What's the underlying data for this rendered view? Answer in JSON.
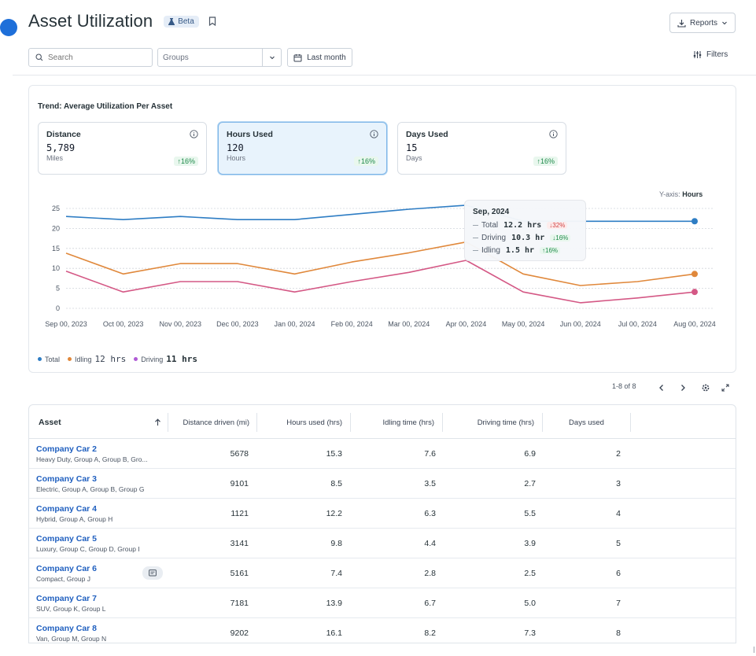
{
  "header": {
    "title": "Asset Utilization",
    "badge": "Beta",
    "reports_label": "Reports"
  },
  "toolbar": {
    "search_placeholder": "Search",
    "groups_placeholder": "Groups",
    "date_label": "Last month",
    "filters_label": "Filters"
  },
  "trend": {
    "title": "Trend: Average Utilization Per Asset",
    "kpis": [
      {
        "label": "Distance",
        "value": "5,789",
        "unit": "Miles",
        "change": "↑16%"
      },
      {
        "label": "Hours Used",
        "value": "120",
        "unit": "Hours",
        "change": "↑16%"
      },
      {
        "label": "Days Used",
        "value": "15",
        "unit": "Days",
        "change": "↑16%"
      }
    ],
    "yaxis_prefix": "Y-axis:",
    "yaxis_value": "Hours",
    "tooltip": {
      "title": "Sep, 2024",
      "rows": [
        {
          "label": "Total",
          "value": "12.2 hrs",
          "change": "↓32%",
          "dir": "down"
        },
        {
          "label": "Driving",
          "value": "10.3 hr",
          "change": "↓16%",
          "dir": "down"
        },
        {
          "label": "Idling",
          "value": "1.5 hr",
          "change": "↑16%",
          "dir": "up"
        }
      ]
    },
    "legend": {
      "total": "Total",
      "idling": "Idling",
      "idling_value": "12 hrs",
      "driving": "Driving",
      "driving_value": "11 hrs"
    }
  },
  "chart_data": {
    "type": "line",
    "x": [
      "Sep 00, 2023",
      "Oct 00, 2023",
      "Nov 00, 2023",
      "Dec 00, 2023",
      "Jan 00, 2024",
      "Feb 00, 2024",
      "Mar 00, 2024",
      "Apr 00, 2024",
      "May 00, 2024",
      "Jun 00, 2024",
      "Jul 00, 2024",
      "Aug 00, 2024"
    ],
    "yticks": [
      0,
      5,
      10,
      15,
      20,
      25
    ],
    "ylim": [
      0,
      25
    ],
    "series": [
      {
        "name": "Total",
        "color": "#2e7dc4",
        "values": [
          23,
          22.2,
          23,
          22.2,
          22.2,
          23.5,
          24.8,
          25.8,
          21.8,
          21.8,
          21.8,
          21.8
        ]
      },
      {
        "name": "Idling",
        "color": "#e0883b",
        "values": [
          13.8,
          8.6,
          11.2,
          11.2,
          8.6,
          11.6,
          13.9,
          16.6,
          8.6,
          5.7,
          6.7,
          8.6
        ]
      },
      {
        "name": "Driving",
        "color": "#d45885",
        "values": [
          9.3,
          4.1,
          6.7,
          6.7,
          4.1,
          6.7,
          9.0,
          12.0,
          4.1,
          1.4,
          2.6,
          4.1
        ]
      }
    ],
    "grid": true,
    "legend": "bottom-left"
  },
  "pagination": {
    "label": "1-8 of 8"
  },
  "table": {
    "columns": [
      "Asset",
      "Distance driven (mi)",
      "Hours used (hrs)",
      "Idling time (hrs)",
      "Driving time (hrs)",
      "Days used"
    ],
    "rows": [
      {
        "name": "Company Car 2",
        "sub": "Heavy Duty, Group A, Group B, Gro...",
        "distance": "5678",
        "hours": "15.3",
        "idling": "7.6",
        "driving": "6.9",
        "days": "2"
      },
      {
        "name": "Company Car 3",
        "sub": "Electric, Group A, Group B, Group G",
        "distance": "9101",
        "hours": "8.5",
        "idling": "3.5",
        "driving": "2.7",
        "days": "3"
      },
      {
        "name": "Company Car 4",
        "sub": "Hybrid, Group A, Group H",
        "distance": "1121",
        "hours": "12.2",
        "idling": "6.3",
        "driving": "5.5",
        "days": "4"
      },
      {
        "name": "Company Car 5",
        "sub": "Luxury, Group C, Group D, Group I",
        "distance": "3141",
        "hours": "9.8",
        "idling": "4.4",
        "driving": "3.9",
        "days": "5"
      },
      {
        "name": "Company Car 6",
        "sub": "Compact, Group J",
        "distance": "5161",
        "hours": "7.4",
        "idling": "2.8",
        "driving": "2.5",
        "days": "6"
      },
      {
        "name": "Company Car 7",
        "sub": "SUV, Group K, Group L",
        "distance": "7181",
        "hours": "13.9",
        "idling": "6.7",
        "driving": "5.0",
        "days": "7"
      },
      {
        "name": "Company Car 8",
        "sub": "Van, Group M, Group N",
        "distance": "9202",
        "hours": "16.1",
        "idling": "8.2",
        "driving": "7.3",
        "days": "8"
      }
    ]
  }
}
